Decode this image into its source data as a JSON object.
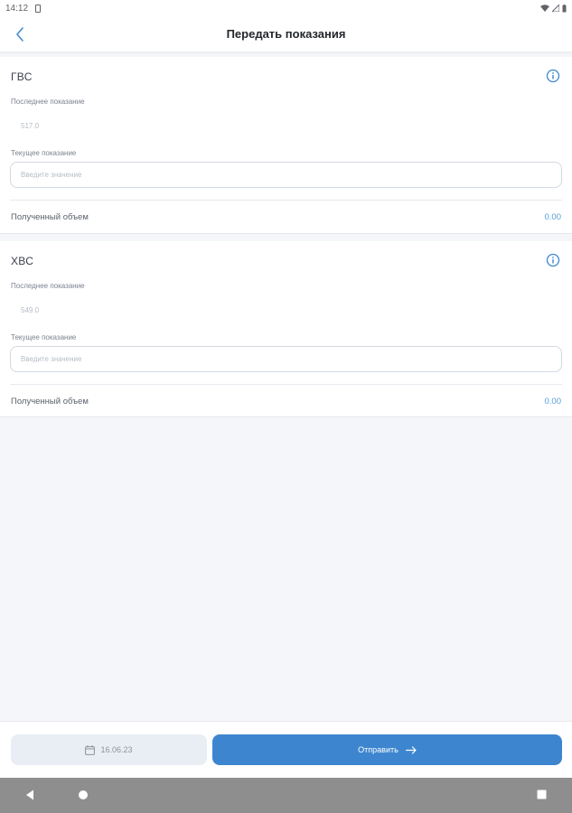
{
  "status_bar": {
    "time": "14:12"
  },
  "header": {
    "title": "Передать показания"
  },
  "meters": [
    {
      "name": "ГВС",
      "last_label": "Последнее показание",
      "last_value": "517.0",
      "current_label": "Текущее показание",
      "current_placeholder": "Введите значение",
      "current_value": "",
      "volume_label": "Полученный объем",
      "volume_value": "0.00"
    },
    {
      "name": "ХВС",
      "last_label": "Последнее показание",
      "last_value": "549.0",
      "current_label": "Текущее показание",
      "current_placeholder": "Введите значение",
      "current_value": "",
      "volume_label": "Полученный объем",
      "volume_value": "0.00"
    }
  ],
  "footer": {
    "date": "16.06.23",
    "send_label": "Отправить"
  },
  "icons": {
    "back": "chevron-left-icon",
    "info": "info-circle-icon",
    "calendar": "calendar-icon",
    "arrow": "arrow-right-icon"
  },
  "colors": {
    "accent": "#3d86cf",
    "background": "#f4f6f9",
    "volume_value": "#5a9ad9"
  }
}
